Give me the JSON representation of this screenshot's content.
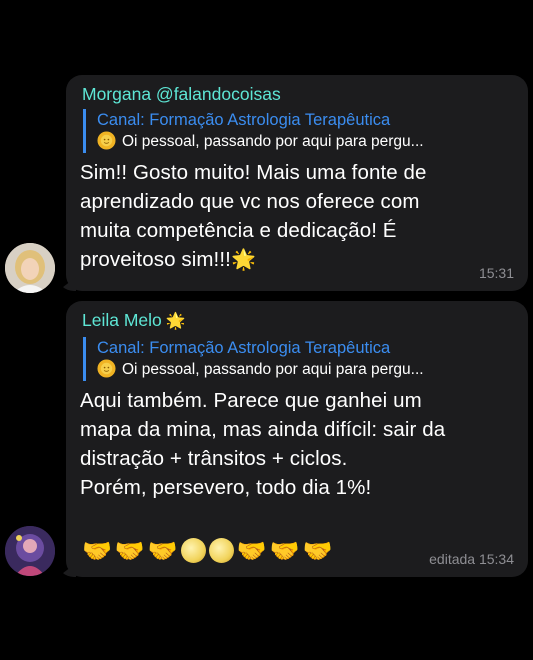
{
  "messages": [
    {
      "sender": "Morgana @falandocoisas",
      "reply": {
        "title": "Canal: Formação Astrologia Terapêutica",
        "text": "Oi pessoal, passando por aqui para pergu..."
      },
      "text": "Sim!! Gosto muito! Mais uma fonte de\naprendizado que vc nos  oferece com\nmuita competência e dedicação! É\nproveitoso sim!!!",
      "sparkle": "🌟",
      "time": "15:31"
    },
    {
      "sender": "Leila Melo",
      "sender_star": "🌟",
      "reply": {
        "title": "Canal: Formação Astrologia Terapêutica",
        "text": "Oi pessoal, passando por aqui para pergu..."
      },
      "text": "Aqui também. Parece que ganhei um\nmapa da mina, mas ainda difícil: sair da\ndistração + trânsitos + ciclos.\nPorém, persevero, todo dia 1%!",
      "emojis": [
        "🤝",
        "🤝",
        "🤝",
        "moon",
        "moon",
        "🤝",
        "🤝",
        "🤝"
      ],
      "time": "editada 15:34"
    }
  ],
  "colors": {
    "background": "#000000",
    "bubble": "#1c1c1e",
    "sender_name": "#5ee6d5",
    "reply_accent": "#3b8df0",
    "timestamp": "#8e8e93"
  },
  "icons": [
    "sun-icon",
    "sparkle-star-icon",
    "handshake-icon",
    "full-moon-icon"
  ]
}
